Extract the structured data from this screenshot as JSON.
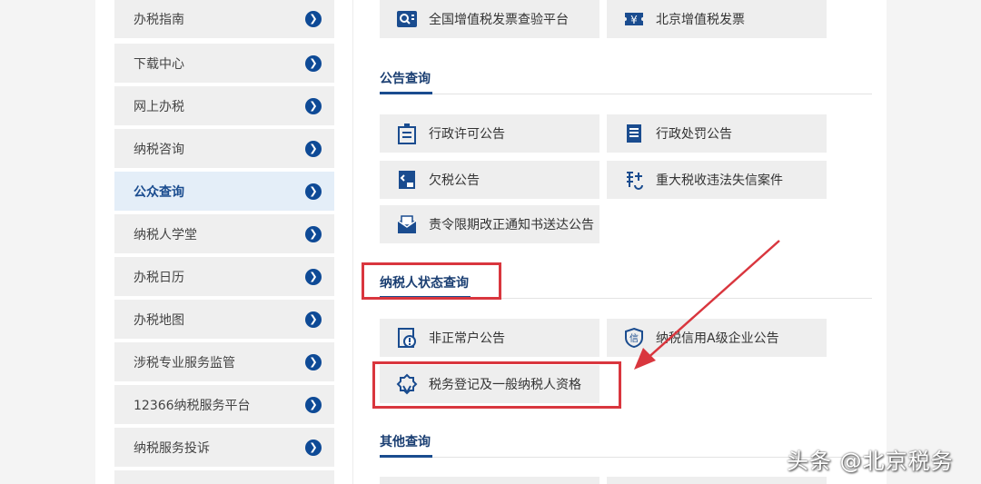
{
  "sidebar": {
    "items": [
      {
        "label": "办税指南"
      },
      {
        "label": "下载中心"
      },
      {
        "label": "网上办税"
      },
      {
        "label": "纳税咨询"
      },
      {
        "label": "公众查询"
      },
      {
        "label": "纳税人学堂"
      },
      {
        "label": "办税日历"
      },
      {
        "label": "办税地图"
      },
      {
        "label": "涉税专业服务监管"
      },
      {
        "label": "12366纳税服务平台"
      },
      {
        "label": "纳税服务投诉"
      }
    ],
    "active_index": 4,
    "arrow_icon": "chevron-right-circle-icon"
  },
  "top_cards": {
    "invoice_check": "全国增值税发票查验平台",
    "beijing_invoice": "北京增值税发票"
  },
  "sections": {
    "announcements": {
      "title": "公告查询",
      "items": {
        "admin_license": "行政许可公告",
        "admin_penalty": "行政处罚公告",
        "tax_arrears": "欠税公告",
        "major_violation": "重大税收违法失信案件",
        "rectification_notice": "责令限期改正通知书送达公告"
      }
    },
    "taxpayer_status": {
      "title": "纳税人状态查询",
      "items": {
        "abnormal_households": "非正常户公告",
        "a_grade_credit": "纳税信用A级企业公告",
        "registration": "税务登记及一般纳税人资格"
      }
    },
    "other": {
      "title": "其他查询"
    }
  },
  "watermark": "头条 @北京税务",
  "colors": {
    "brand": "#0e4a96",
    "highlight": "#d9363e",
    "card_bg": "#eeeeee"
  }
}
